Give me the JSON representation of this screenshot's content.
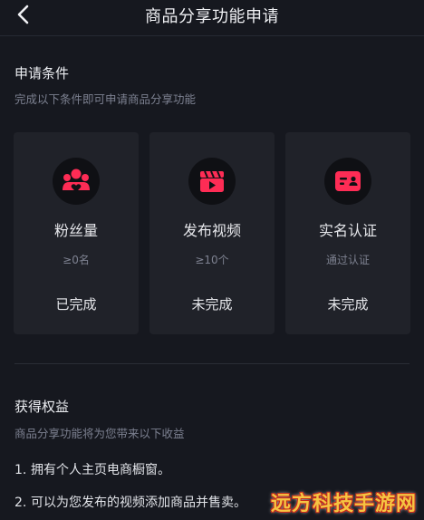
{
  "header": {
    "title": "商品分享功能申请",
    "back_icon": "chevron-left-icon"
  },
  "conditions": {
    "title": "申请条件",
    "subtitle": "完成以下条件即可申请商品分享功能",
    "cards": [
      {
        "icon": "fans-icon",
        "label": "粉丝量",
        "requirement": "≥0名",
        "status": "已完成"
      },
      {
        "icon": "video-clapper-icon",
        "label": "发布视频",
        "requirement": "≥10个",
        "status": "未完成"
      },
      {
        "icon": "id-card-icon",
        "label": "实名认证",
        "requirement": "通过认证",
        "status": "未完成"
      }
    ]
  },
  "benefits": {
    "title": "获得权益",
    "subtitle": "商品分享功能将为您带来以下收益",
    "items": [
      {
        "num": "1.",
        "text": "拥有个人主页电商橱窗。"
      },
      {
        "num": "2.",
        "text": "可以为您发布的视频添加商品并售卖。"
      }
    ]
  },
  "watermark": "远方科技手游网",
  "colors": {
    "accent": "#fe2c55",
    "background": "#16181f",
    "card": "#202229"
  }
}
